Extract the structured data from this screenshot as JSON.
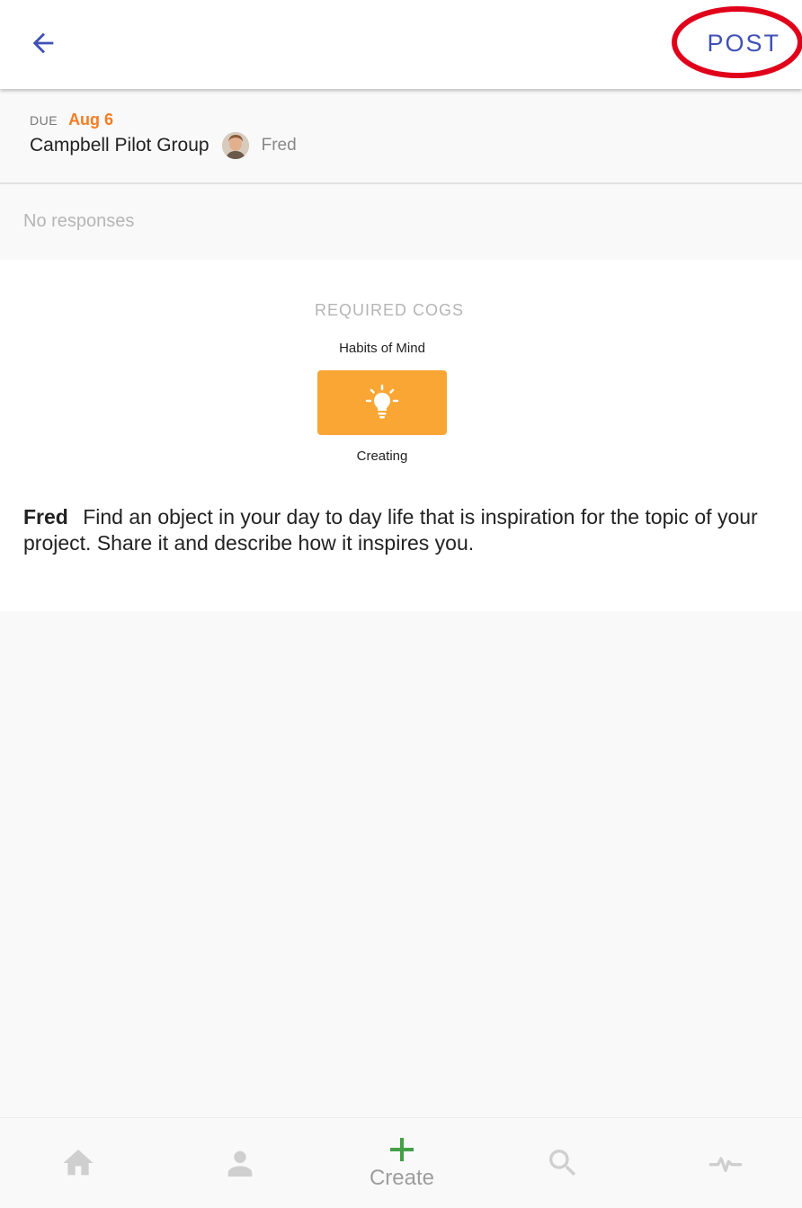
{
  "header": {
    "back_icon": "arrow-left-icon",
    "post_label": "POST",
    "accent_color": "#3f51b5",
    "highlight_color": "#e0001a"
  },
  "assignment": {
    "due_label": "DUE",
    "due_date": "Aug 6",
    "group_name": "Campbell Pilot Group",
    "author_name": "Fred"
  },
  "responses": {
    "empty_text": "No responses"
  },
  "cogs": {
    "title": "REQUIRED COGS",
    "category": "Habits of Mind",
    "items": [
      {
        "name": "Creating",
        "icon": "lightbulb-icon",
        "color": "#f9a634"
      }
    ]
  },
  "prompt": {
    "author": "Fred",
    "text": "Find an object in your day to day life that is inspiration for the topic of your project. Share it and describe how it inspires you."
  },
  "bottom_nav": {
    "items": [
      {
        "icon": "home-icon",
        "label": ""
      },
      {
        "icon": "profile-icon",
        "label": ""
      },
      {
        "icon": "plus-icon",
        "label": "Create",
        "color": "#43a047"
      },
      {
        "icon": "search-icon",
        "label": ""
      },
      {
        "icon": "activity-icon",
        "label": ""
      }
    ]
  }
}
